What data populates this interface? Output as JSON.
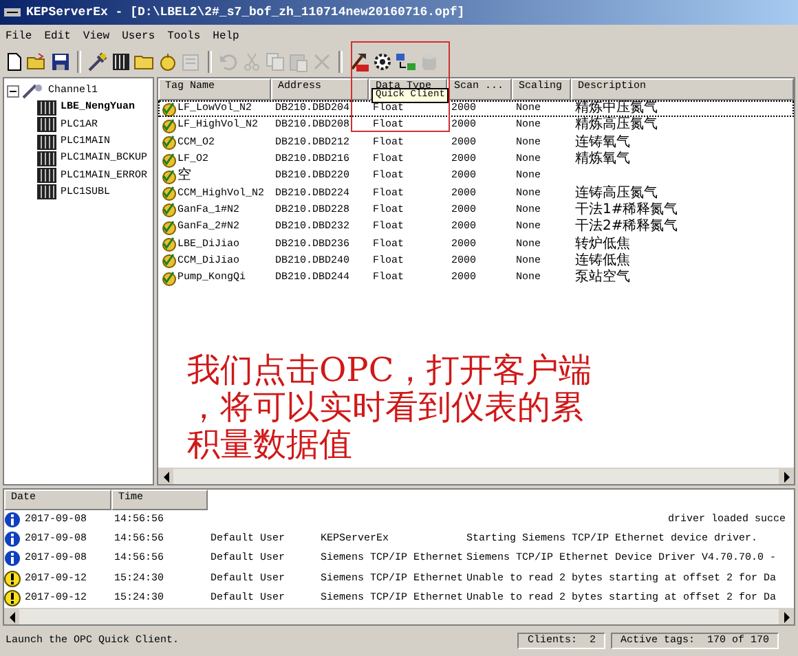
{
  "window": {
    "title": "KEPServerEx - [D:\\LBEL2\\2#_s7_bof_zh_110714new20160716.opf]"
  },
  "menu": [
    "File",
    "Edit",
    "View",
    "Users",
    "Tools",
    "Help"
  ],
  "toolbar": [
    {
      "kind": "new",
      "disabled": false
    },
    {
      "kind": "open",
      "disabled": false
    },
    {
      "kind": "save",
      "disabled": false
    },
    {
      "kind": "sep"
    },
    {
      "kind": "channel",
      "disabled": false
    },
    {
      "kind": "device",
      "disabled": false
    },
    {
      "kind": "group",
      "disabled": false
    },
    {
      "kind": "tag",
      "disabled": false
    },
    {
      "kind": "properties",
      "disabled": true
    },
    {
      "kind": "sep"
    },
    {
      "kind": "undo",
      "disabled": true
    },
    {
      "kind": "cut",
      "disabled": true
    },
    {
      "kind": "copy",
      "disabled": true
    },
    {
      "kind": "paste",
      "disabled": true
    },
    {
      "kind": "delete",
      "disabled": true
    },
    {
      "kind": "sep"
    },
    {
      "kind": "quick-client",
      "disabled": false
    },
    {
      "kind": "gear",
      "disabled": false
    },
    {
      "kind": "connect",
      "disabled": false
    },
    {
      "kind": "database",
      "disabled": true
    }
  ],
  "tooltip": "Quick Client",
  "tree": [
    {
      "label": "Channel1",
      "expanded": true,
      "children": [
        {
          "label": "LBE_NengYuan",
          "selected": true
        },
        {
          "label": "PLC1AR",
          "selected": false
        },
        {
          "label": "PLC1MAIN",
          "selected": false
        },
        {
          "label": "PLC1MAIN_BCKUP",
          "selected": false
        },
        {
          "label": "PLC1MAIN_ERROR",
          "selected": false
        },
        {
          "label": "PLC1SUBL",
          "selected": false
        }
      ]
    }
  ],
  "tag_table": {
    "columns": [
      "Tag Name",
      "Address",
      "Data Type",
      "Scan ...",
      "Scaling",
      "Description"
    ],
    "rows": [
      {
        "selected": true,
        "cells": [
          "LF_LowVol_N2",
          "DB210.DBD204",
          "Float",
          "2000",
          "None",
          "精炼中压氮气"
        ]
      },
      {
        "selected": false,
        "cells": [
          "LF_HighVol_N2",
          "DB210.DBD208",
          "Float",
          "2000",
          "None",
          "精炼高压氮气"
        ]
      },
      {
        "selected": false,
        "cells": [
          "CCM_O2",
          "DB210.DBD212",
          "Float",
          "2000",
          "None",
          "连铸氧气"
        ]
      },
      {
        "selected": false,
        "cells": [
          "LF_O2",
          "DB210.DBD216",
          "Float",
          "2000",
          "None",
          "精炼氧气"
        ]
      },
      {
        "selected": false,
        "cells": [
          "空",
          "DB210.DBD220",
          "Float",
          "2000",
          "None",
          ""
        ]
      },
      {
        "selected": false,
        "cells": [
          "CCM_HighVol_N2",
          "DB210.DBD224",
          "Float",
          "2000",
          "None",
          "连铸高压氮气"
        ]
      },
      {
        "selected": false,
        "cells": [
          "GanFa_1#N2",
          "DB210.DBD228",
          "Float",
          "2000",
          "None",
          "干法1#稀释氮气"
        ]
      },
      {
        "selected": false,
        "cells": [
          "GanFa_2#N2",
          "DB210.DBD232",
          "Float",
          "2000",
          "None",
          "干法2#稀释氮气"
        ]
      },
      {
        "selected": false,
        "cells": [
          "LBE_DiJiao",
          "DB210.DBD236",
          "Float",
          "2000",
          "None",
          "转炉低焦"
        ]
      },
      {
        "selected": false,
        "cells": [
          "CCM_DiJiao",
          "DB210.DBD240",
          "Float",
          "2000",
          "None",
          "连铸低焦"
        ]
      },
      {
        "selected": false,
        "cells": [
          "Pump_KongQi",
          "DB210.DBD244",
          "Float",
          "2000",
          "None",
          "泵站空气"
        ]
      }
    ]
  },
  "log": {
    "columns": [
      "Date",
      "Time"
    ],
    "rows": [
      {
        "kind": "info",
        "date": "2017-09-08",
        "time": "14:56:56",
        "event": "driver loaded succe"
      },
      {
        "kind": "info",
        "date": "2017-09-08",
        "time": "14:56:56",
        "user": "Default User",
        "source": "KEPServerEx",
        "event": "Starting Siemens TCP/IP Ethernet device driver."
      },
      {
        "kind": "info",
        "date": "2017-09-08",
        "time": "14:56:56",
        "user": "Default User",
        "source": "Siemens TCP/IP Ethernet",
        "event": "Siemens TCP/IP Ethernet Device Driver V4.70.70.0 -"
      },
      {
        "kind": "warning",
        "date": "2017-09-12",
        "time": "15:24:30",
        "user": "Default User",
        "source": "Siemens TCP/IP Ethernet",
        "event": "Unable to read 2 bytes starting at offset 2 for Da"
      },
      {
        "kind": "warning",
        "date": "2017-09-12",
        "time": "15:24:30",
        "user": "Default User",
        "source": "Siemens TCP/IP Ethernet",
        "event": "Unable to read 2 bytes starting at offset 2 for Da"
      }
    ]
  },
  "status_bar": {
    "message": "Launch the OPC Quick Client.",
    "clients": "Clients:  2",
    "active_tags": "Active tags:  170 of 170"
  },
  "annotation": {
    "lines": [
      "我们点击OPC，打开客户端",
      "，将可以实时看到仪表的累",
      "积量数据值"
    ]
  }
}
